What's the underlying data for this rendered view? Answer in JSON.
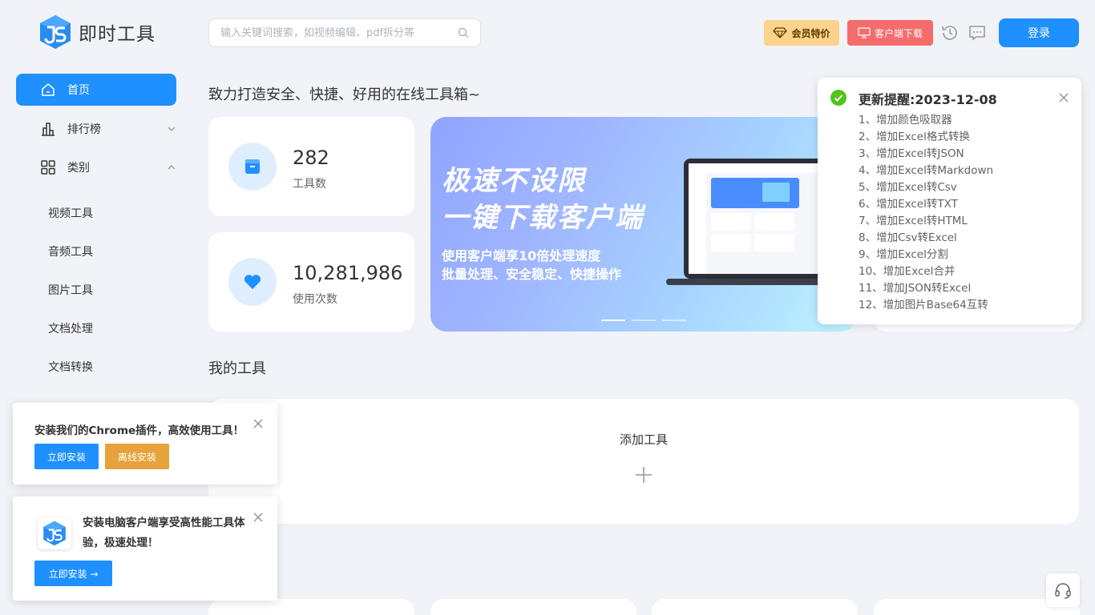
{
  "app": {
    "title": "即时工具"
  },
  "search": {
    "placeholder": "输入关键词搜索，如视频编辑、pdf拆分等",
    "value": ""
  },
  "header": {
    "vip_label": "会员特价",
    "download_label": "客户端下载",
    "login_label": "登录"
  },
  "sidebar": {
    "items": [
      {
        "label": "首页",
        "icon": "home-icon",
        "active": true
      },
      {
        "label": "排行榜",
        "icon": "bar-chart-icon"
      },
      {
        "label": "类别",
        "icon": "grid-icon"
      }
    ],
    "sub_items": [
      "视频工具",
      "音频工具",
      "图片工具",
      "文档处理",
      "文档转换"
    ]
  },
  "main": {
    "slogan": "致力打造安全、快捷、好用的在线工具箱~",
    "stats": [
      {
        "value": "282",
        "label": "工具数",
        "icon": "box-icon"
      },
      {
        "value": "10,281,986",
        "label": "使用次数",
        "icon": "heart-icon"
      }
    ],
    "banner": {
      "headline1": "极速不设限",
      "headline2": "一键下载客户端",
      "sub1": "使用客户端享10倍处理速度",
      "sub2": "批量处理、安全稳定、快捷操作"
    },
    "my_tools_title": "我的工具",
    "add_tool_label": "添加工具"
  },
  "notification": {
    "title": "更新提醒:2023-12-08",
    "items": [
      "1、增加颜色吸取器",
      "2、增加Excel格式转换",
      "3、增加Excel转JSON",
      "4、增加Excel转Markdown",
      "5、增加Excel转Csv",
      "6、增加Excel转TXT",
      "7、增加Excel转HTML",
      "8、增加Csv转Excel",
      "9、增加Excel分割",
      "10、增加Excel合并",
      "11、增加JSON转Excel",
      "12、增加图片Base64互转"
    ]
  },
  "chrome_popup": {
    "text": "安装我们的Chrome插件，高效使用工具！",
    "install_label": "立即安装",
    "offline_label": "离线安装"
  },
  "client_popup": {
    "text": "安装电脑客户端享受高性能工具体验，极速处理！",
    "install_label": "立即安装 →"
  },
  "colors": {
    "primary": "#1e90ff",
    "vip": "#fbd38a",
    "download": "#f56c6c",
    "success": "#52c41a",
    "orange": "#e6a23c"
  }
}
